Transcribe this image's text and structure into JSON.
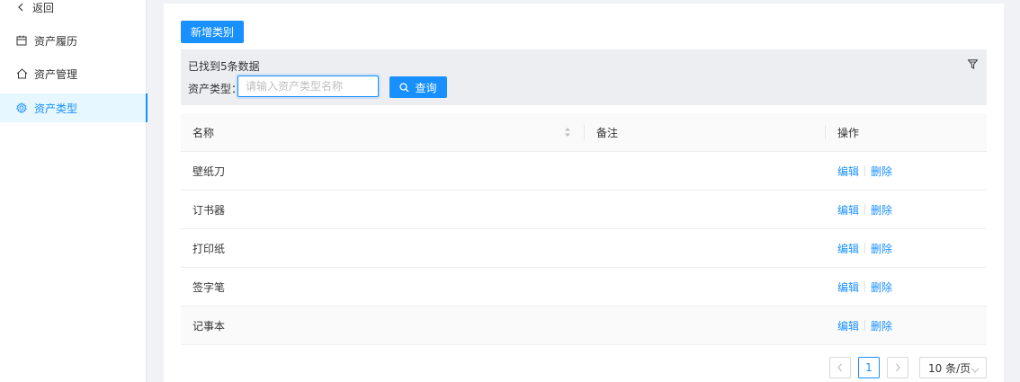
{
  "sidebar": {
    "back_label": "返回",
    "items": [
      {
        "label": "资产履历"
      },
      {
        "label": "资产管理"
      },
      {
        "label": "资产类型"
      }
    ]
  },
  "toolbar": {
    "add_category_label": "新增类别"
  },
  "filter": {
    "found_text": "已找到5条数据",
    "field_label": "资产类型：",
    "input_placeholder": "请输入资产类型名称",
    "input_value": "",
    "search_label": "查询"
  },
  "table": {
    "columns": {
      "name": "名称",
      "remark": "备注",
      "action": "操作"
    },
    "rows": [
      {
        "name": "壁纸刀",
        "remark": "",
        "edit": "编辑",
        "delete": "删除"
      },
      {
        "name": "订书器",
        "remark": "",
        "edit": "编辑",
        "delete": "删除"
      },
      {
        "name": "打印纸",
        "remark": "",
        "edit": "编辑",
        "delete": "删除"
      },
      {
        "name": "签字笔",
        "remark": "",
        "edit": "编辑",
        "delete": "删除"
      },
      {
        "name": "记事本",
        "remark": "",
        "edit": "编辑",
        "delete": "删除"
      }
    ]
  },
  "pagination": {
    "prev_icon": "chevron-left-icon",
    "current_page": "1",
    "next_icon": "chevron-right-icon",
    "page_size": "10 条/页"
  },
  "colors": {
    "primary": "#1890ff",
    "active_bg": "#e6f7ff",
    "page_bg": "#f0f2f5",
    "filter_bg": "#eceef2"
  }
}
